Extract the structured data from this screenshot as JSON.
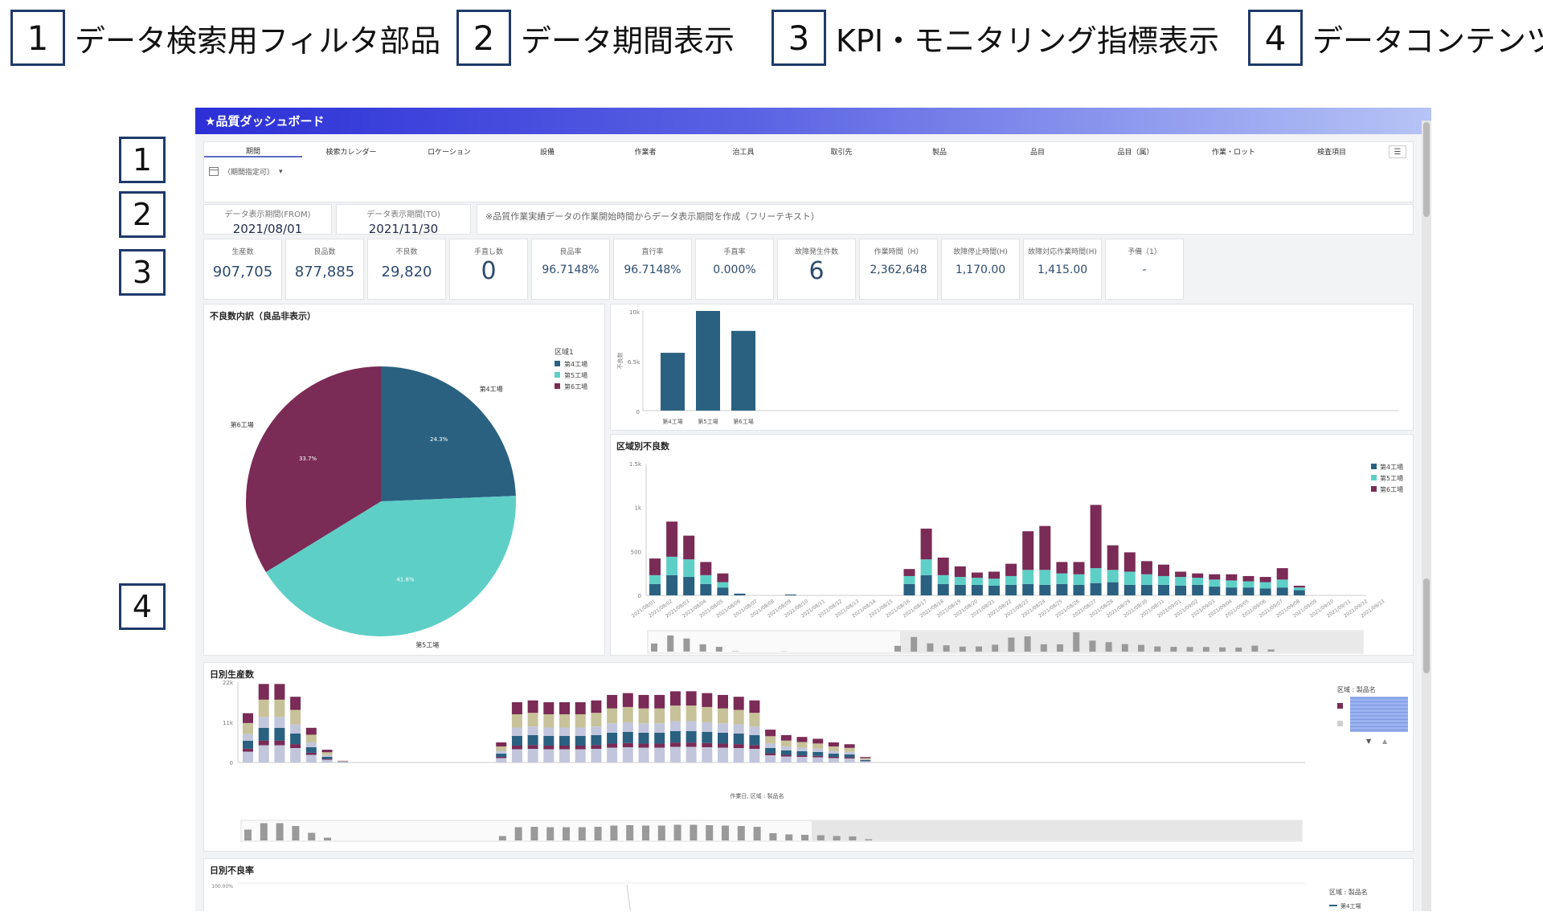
{
  "legend": [
    {
      "num": "1",
      "text": "データ検索用フィルタ部品"
    },
    {
      "num": "2",
      "text": "データ期間表示"
    },
    {
      "num": "3",
      "text": "KPI・モニタリング指標表示"
    },
    {
      "num": "4",
      "text": "データコンテンツ"
    }
  ],
  "side_numbers": [
    "1",
    "2",
    "3",
    "4"
  ],
  "dashboard": {
    "title": "★品質ダッシュボード",
    "filter_tabs": [
      "期間",
      "検索カレンダー",
      "ロケーション",
      "設備",
      "作業者",
      "治工具",
      "取引先",
      "製品",
      "品目",
      "品目（属）",
      "作業・ロット",
      "検査項目"
    ],
    "filter_date_text": "（期間指定可）",
    "period_from_label": "データ表示期間(FROM)",
    "period_from": "2021/08/01",
    "period_to_label": "データ表示期間(TO)",
    "period_to": "2021/11/30",
    "period_note": "※品質作業実績データの作業開始時間からデータ表示期間を作成（フリーテキスト）",
    "kpis": [
      {
        "label": "生産数",
        "value": "907,705"
      },
      {
        "label": "良品数",
        "value": "877,885"
      },
      {
        "label": "不良数",
        "value": "29,820"
      },
      {
        "label": "手直し数",
        "value": "0"
      },
      {
        "label": "良品率",
        "value": "96.7148%"
      },
      {
        "label": "直行率",
        "value": "96.7148%"
      },
      {
        "label": "手直率",
        "value": "0.000%"
      },
      {
        "label": "故障発生件数",
        "value": "6"
      },
      {
        "label": "作業時間（H）",
        "value": "2,362,648"
      },
      {
        "label": "故障停止時間(H)",
        "value": "1,170.00"
      },
      {
        "label": "故障対応作業時間(H)",
        "value": "1,415.00"
      },
      {
        "label": "予備（1）",
        "value": "-"
      }
    ],
    "colors": {
      "s4": "#2a6181",
      "s5": "#5ecfc7",
      "s6": "#7a2b56",
      "tan": "#c8c29a",
      "lav": "#c2c6dc"
    }
  },
  "chart_data": [
    {
      "type": "pie",
      "title": "不良数内訳（良品非表示）",
      "legend_title": "区域1",
      "labels": [
        "第4工場",
        "第5工場",
        "第6工場"
      ],
      "values": [
        24.3,
        41.8,
        33.7
      ],
      "value_labels": [
        "24.3%",
        "41.8%",
        "33.7%"
      ],
      "legend_position": "right"
    },
    {
      "type": "bar",
      "title": "",
      "ylabel": "不良数",
      "yticks": [
        "10k",
        "6.5k",
        "0"
      ],
      "ylim": [
        0,
        10000
      ],
      "categories": [
        "第4工場",
        "第5工場",
        "第6工場"
      ],
      "values": [
        5800,
        10000,
        8000
      ]
    },
    {
      "type": "bar",
      "stacked": true,
      "title": "区域別不良数",
      "yticks": [
        "1.5k",
        "1k",
        "500",
        "0"
      ],
      "ylim": [
        0,
        1500
      ],
      "legend": [
        "第4工場",
        "第5工場",
        "第6工場"
      ],
      "legend_position": "top-right",
      "categories": [
        "2021/08/01",
        "2021/08/02",
        "2021/08/03",
        "2021/08/04",
        "2021/08/05",
        "2021/08/06",
        "2021/08/07",
        "2021/08/08",
        "2021/08/09",
        "2021/08/10",
        "2021/08/11",
        "2021/08/12",
        "2021/08/13",
        "2021/08/14",
        "2021/08/15",
        "2021/08/16",
        "2021/08/17",
        "2021/08/18",
        "2021/08/19",
        "2021/08/20",
        "2021/08/21",
        "2021/08/22",
        "2021/08/23",
        "2021/08/24",
        "2021/08/25",
        "2021/08/26",
        "2021/08/27",
        "2021/08/28",
        "2021/08/29",
        "2021/08/30",
        "2021/08/31",
        "2021/09/01",
        "2021/09/02",
        "2021/09/03",
        "2021/09/04",
        "2021/09/05",
        "2021/09/06",
        "2021/09/07",
        "2021/09/08",
        "2021/09/09",
        "2021/09/10",
        "2021/09/11",
        "2021/09/12",
        "2021/09/13"
      ],
      "series": [
        {
          "name": "第4工場",
          "values": [
            130,
            230,
            210,
            130,
            90,
            20,
            0,
            0,
            10,
            0,
            0,
            0,
            0,
            0,
            0,
            130,
            230,
            130,
            120,
            120,
            110,
            120,
            130,
            120,
            130,
            120,
            140,
            150,
            120,
            120,
            120,
            110,
            120,
            100,
            90,
            90,
            80,
            90,
            60,
            0,
            0,
            0,
            0,
            0
          ]
        },
        {
          "name": "第5工場",
          "values": [
            100,
            210,
            200,
            100,
            60,
            0,
            0,
            0,
            0,
            0,
            0,
            0,
            0,
            0,
            0,
            90,
            180,
            100,
            90,
            80,
            80,
            100,
            160,
            170,
            120,
            120,
            170,
            140,
            150,
            120,
            100,
            100,
            80,
            80,
            80,
            70,
            70,
            90,
            30,
            0,
            0,
            0,
            0,
            0
          ]
        },
        {
          "name": "第6工場",
          "values": [
            190,
            400,
            270,
            150,
            100,
            0,
            0,
            0,
            0,
            0,
            0,
            0,
            0,
            0,
            0,
            80,
            350,
            200,
            120,
            60,
            80,
            140,
            440,
            500,
            130,
            140,
            720,
            280,
            220,
            150,
            130,
            60,
            50,
            60,
            70,
            60,
            60,
            130,
            20,
            0,
            0,
            0,
            0,
            0
          ]
        }
      ]
    },
    {
      "type": "bar",
      "stacked": true,
      "title": "日別生産数",
      "xlabel": "作業日, 区域 : 製品名",
      "yticks": [
        "22k",
        "11k",
        "0"
      ],
      "ylim": [
        0,
        22000
      ],
      "legend_title": "区域 : 製品名",
      "legend_position": "right",
      "values": [
        13500,
        21500,
        21500,
        18000,
        9500,
        3500,
        500,
        0,
        0,
        0,
        0,
        0,
        0,
        0,
        0,
        0,
        5500,
        16500,
        17000,
        16500,
        16500,
        16500,
        17000,
        18500,
        19000,
        18500,
        18500,
        19500,
        19500,
        19000,
        18500,
        18000,
        17000,
        9000,
        7500,
        7000,
        6500,
        5500,
        5000,
        1500,
        200,
        200,
        100,
        100,
        100,
        100,
        100,
        100,
        100,
        100,
        100,
        100,
        100,
        100,
        100,
        100,
        100,
        100,
        100,
        100,
        100,
        100,
        100,
        100,
        100,
        100
      ]
    },
    {
      "type": "line",
      "title": "日別不良率",
      "yticks": [
        "100.00%"
      ],
      "legend_title": "区域 : 製品名",
      "legend": [
        "第4工場"
      ],
      "legend_position": "right"
    }
  ]
}
